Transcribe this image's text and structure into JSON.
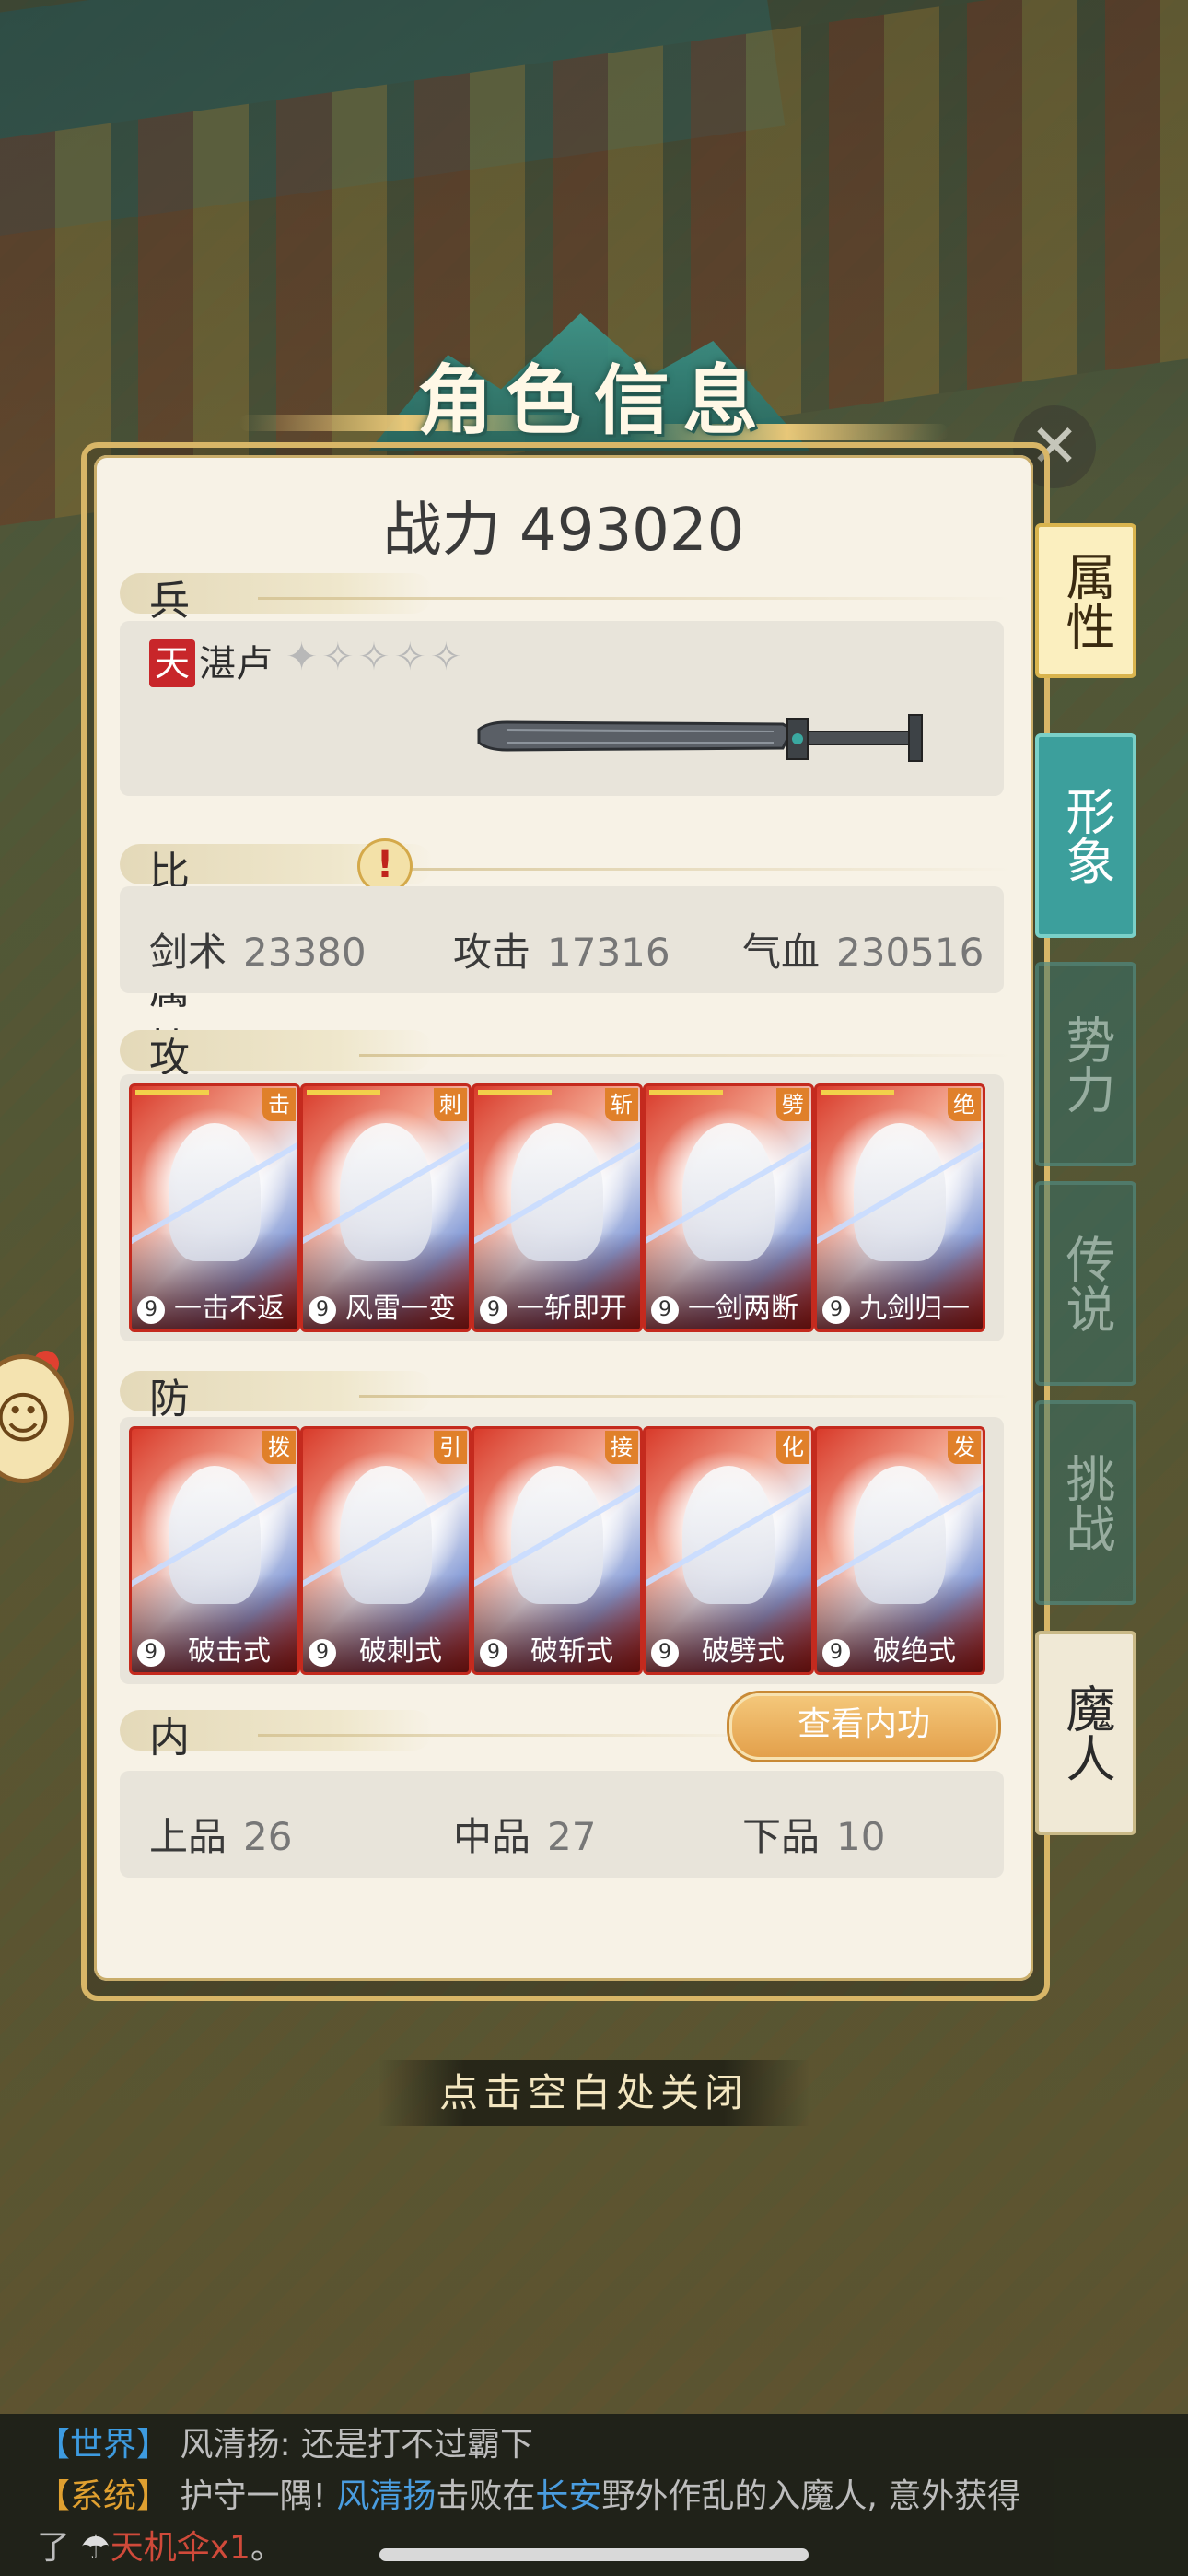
{
  "title": "角色信息",
  "power": "战力 493020",
  "weapon": {
    "section": "兵器",
    "grade": "天",
    "name": "湛卢",
    "stars": "✦✧✧✧✧"
  },
  "attributes": {
    "section": "比武属性",
    "items": [
      {
        "label": "剑术",
        "value": "23380"
      },
      {
        "label": "攻击",
        "value": "17316"
      },
      {
        "label": "气血",
        "value": "230516"
      }
    ]
  },
  "attack": {
    "section": "攻击招式",
    "cards": [
      {
        "badge": "击",
        "level": "9",
        "name": "一击不返"
      },
      {
        "badge": "刺",
        "level": "9",
        "name": "风雷一变"
      },
      {
        "badge": "斩",
        "level": "9",
        "name": "一斩即开"
      },
      {
        "badge": "劈",
        "level": "9",
        "name": "一剑两断"
      },
      {
        "badge": "绝",
        "level": "9",
        "name": "九剑归一"
      }
    ]
  },
  "defense": {
    "section": "防御招式",
    "cards": [
      {
        "badge": "拨",
        "level": "9",
        "name": "破击式"
      },
      {
        "badge": "引",
        "level": "9",
        "name": "破刺式"
      },
      {
        "badge": "接",
        "level": "9",
        "name": "破斩式"
      },
      {
        "badge": "化",
        "level": "9",
        "name": "破劈式"
      },
      {
        "badge": "发",
        "level": "9",
        "name": "破绝式"
      }
    ]
  },
  "neigong": {
    "section": "内功",
    "button": "查看内功",
    "items": [
      {
        "label": "上品",
        "value": "26"
      },
      {
        "label": "中品",
        "value": "27"
      },
      {
        "label": "下品",
        "value": "10"
      }
    ]
  },
  "tabs": [
    "属性",
    "形象",
    "势力",
    "传说",
    "挑战",
    "魔人"
  ],
  "close_hint": "点击空白处关闭",
  "chat": {
    "line1_tag": "【世界】",
    "line1_text": "风清扬: 还是打不过霸下",
    "line2_tag": "【系统】",
    "line2_a": "护守一隅! ",
    "line2_name": "风清扬",
    "line2_b": "击败在",
    "line2_place": "长安",
    "line2_c": "野外作乱的入魔人, 意外获得",
    "line3_a": "了",
    "line3_item": "天机伞x1",
    "line3_b": "。"
  }
}
